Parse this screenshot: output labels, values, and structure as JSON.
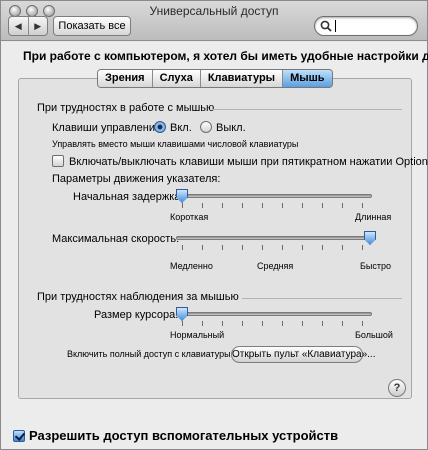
{
  "window": {
    "title": "Универсальный доступ"
  },
  "toolbar": {
    "show_all_label": "Показать все",
    "search": {
      "value": ""
    }
  },
  "heading": "При работе с компьютером, я хотел бы иметь удобные настройки для:",
  "tabs": [
    {
      "label": "Зрения",
      "active": false
    },
    {
      "label": "Слуха",
      "active": false
    },
    {
      "label": "Клавиатуры",
      "active": false
    },
    {
      "label": "Мышь",
      "active": true
    }
  ],
  "mouse_section": {
    "title": "При трудностях в работе с мышью",
    "mouse_keys_label": "Клавиши управления:",
    "on_label": "Вкл.",
    "off_label": "Выкл.",
    "mouse_keys_selected": "on",
    "mouse_keys_hint": "Управлять вместо мыши клавишами числовой клавиатуры",
    "option_toggle_label": "Включать/выключать клавиши мыши при пятикратном нажатии Option",
    "option_toggle_checked": false,
    "pointer_params_label": "Параметры движения указателя:",
    "initial_delay": {
      "label": "Начальная задержка:",
      "min_label": "Короткая",
      "max_label": "Длинная",
      "value": 0.0
    },
    "max_speed": {
      "label": "Максимальная скорость:",
      "min_label": "Медленно",
      "mid_label": "Средняя",
      "max_label": "Быстро",
      "value": 1.0
    }
  },
  "viewing_section": {
    "title": "При трудностях наблюдения за мышью",
    "cursor_size": {
      "label": "Размер курсора:",
      "min_label": "Нормальный",
      "max_label": "Большой",
      "value": 0.0
    }
  },
  "keyboard_access": {
    "label": "Включить полный доступ с клавиатуры:",
    "button_label": "Открыть пульт «Клавиатура»..."
  },
  "assistive_devices": {
    "label": "Разрешить доступ вспомогательных устройств",
    "checked": true
  },
  "colors": {
    "accent": "#3d86d6",
    "panel": "#e2e2e2"
  }
}
